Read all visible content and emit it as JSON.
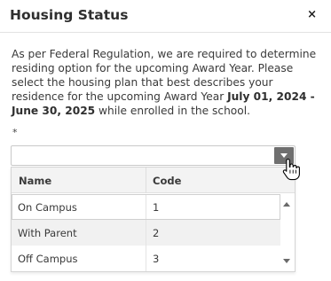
{
  "dialog": {
    "title": "Housing Status",
    "close_label": "×",
    "message_part1": "As per Federal Regulation, we are required to determine residing option for the upcoming Award Year. Please select the housing plan that best describes your residence for the upcoming Award Year ",
    "message_dates": "July 01, 2024 - June 30, 2025",
    "message_part2": " while enrolled in the school.",
    "required_marker": "*"
  },
  "combo": {
    "value": "",
    "placeholder": ""
  },
  "dropdown": {
    "columns": [
      "Name",
      "Code"
    ],
    "rows": [
      {
        "name": "On Campus",
        "code": "1"
      },
      {
        "name": "With Parent",
        "code": "2"
      },
      {
        "name": "Off Campus",
        "code": "3"
      }
    ]
  },
  "icons": {
    "close": "close-icon",
    "dropdown": "chevron-down-icon",
    "scroll_up": "scroll-up-icon",
    "scroll_down": "scroll-down-icon",
    "cursor": "hand-pointer-icon"
  }
}
